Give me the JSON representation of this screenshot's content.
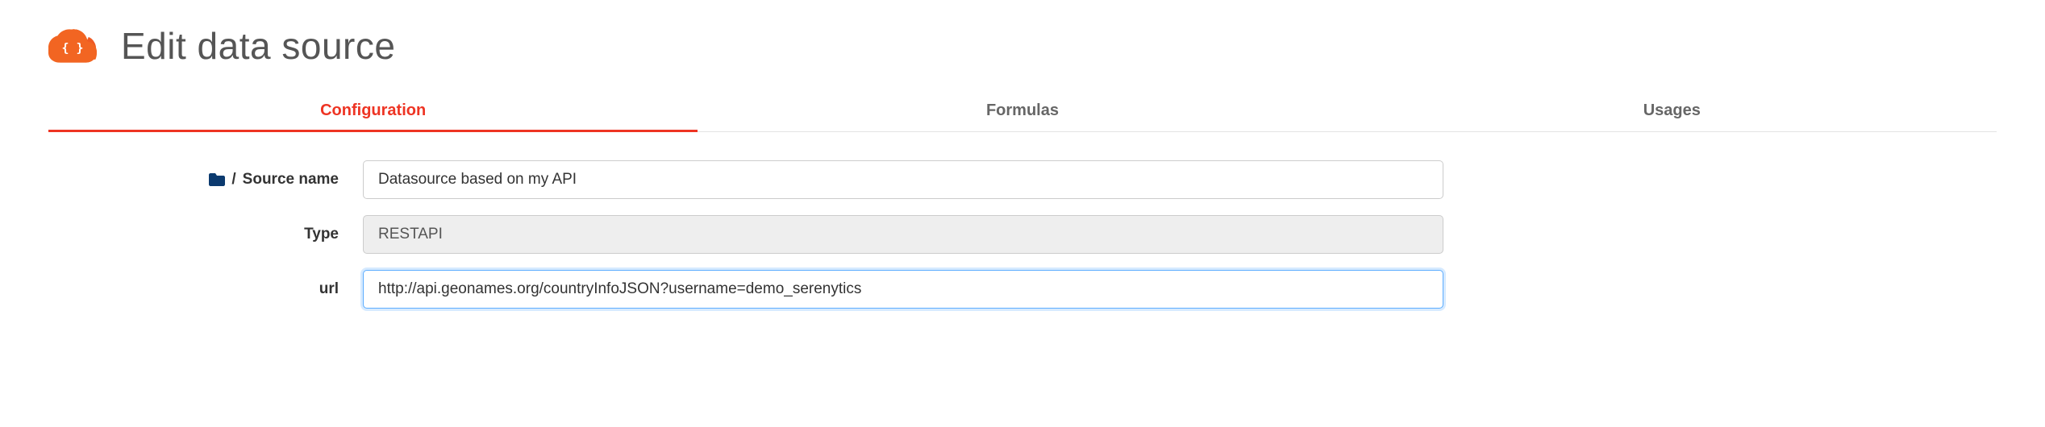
{
  "header": {
    "title": "Edit data source",
    "logo_name": "cloud-braces-icon"
  },
  "tabs": [
    {
      "label": "Configuration",
      "active": true
    },
    {
      "label": "Formulas",
      "active": false
    },
    {
      "label": "Usages",
      "active": false
    }
  ],
  "form": {
    "source_name": {
      "label_prefix": "/",
      "label": "Source name",
      "value": "Datasource based on my API"
    },
    "type": {
      "label": "Type",
      "value": "RESTAPI"
    },
    "url": {
      "label": "url",
      "value": "http://api.geonames.org/countryInfoJSON?username=demo_serenytics"
    }
  },
  "colors": {
    "accent": "#ee3423",
    "focus": "#5cadff"
  }
}
